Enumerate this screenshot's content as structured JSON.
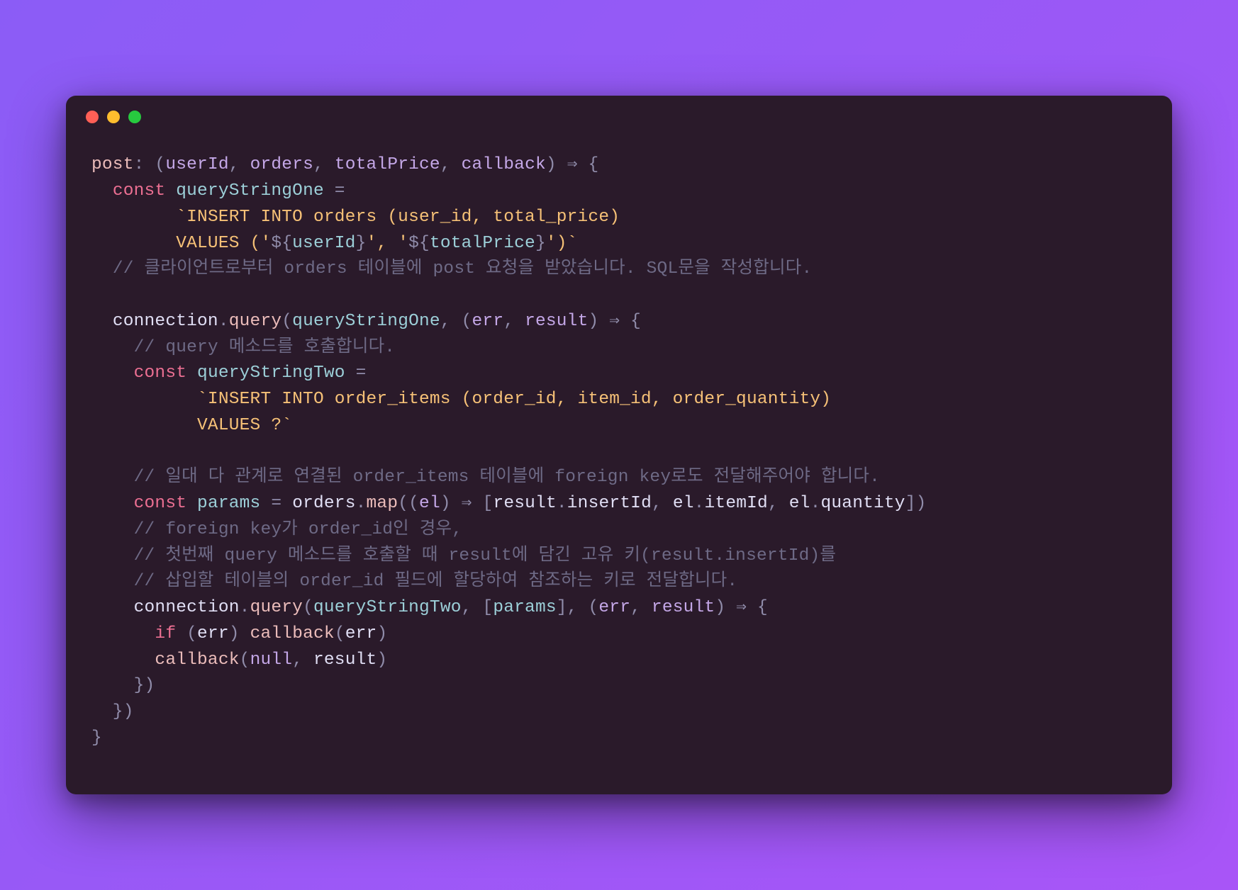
{
  "theme": {
    "bg_gradient_from": "#8b5cf6",
    "bg_gradient_to": "#a855f7",
    "window_bg": "#2a1a2a",
    "dot_red": "#ff5f56",
    "dot_yellow": "#ffbd2e",
    "dot_green": "#27c93f",
    "text_default": "#e0def4",
    "text_keyword": "#eb6f92",
    "text_function": "#ebbcba",
    "text_param": "#c4a7e7",
    "text_variable": "#9ccfd8",
    "text_punct": "#908caa",
    "text_string": "#f6c177",
    "text_comment": "#6e6a86"
  },
  "code": {
    "lines": [
      [
        {
          "t": "post",
          "c": "c-fn"
        },
        {
          "t": ": (",
          "c": "c-punct"
        },
        {
          "t": "userId",
          "c": "c-param"
        },
        {
          "t": ", ",
          "c": "c-punct"
        },
        {
          "t": "orders",
          "c": "c-param"
        },
        {
          "t": ", ",
          "c": "c-punct"
        },
        {
          "t": "totalPrice",
          "c": "c-param"
        },
        {
          "t": ", ",
          "c": "c-punct"
        },
        {
          "t": "callback",
          "c": "c-param"
        },
        {
          "t": ") ",
          "c": "c-punct"
        },
        {
          "t": "⇒",
          "c": "c-punct"
        },
        {
          "t": " {",
          "c": "c-punct"
        }
      ],
      [
        {
          "t": "  ",
          "c": "c-punct"
        },
        {
          "t": "const",
          "c": "c-key"
        },
        {
          "t": " ",
          "c": ""
        },
        {
          "t": "queryStringOne",
          "c": "c-var"
        },
        {
          "t": " = ",
          "c": "c-punct"
        }
      ],
      [
        {
          "t": "        ",
          "c": ""
        },
        {
          "t": "`INSERT INTO orders (user_id, total_price) ",
          "c": "c-str"
        }
      ],
      [
        {
          "t": "        VALUES ('",
          "c": "c-str"
        },
        {
          "t": "${",
          "c": "c-punct"
        },
        {
          "t": "userId",
          "c": "c-tmpl"
        },
        {
          "t": "}",
          "c": "c-punct"
        },
        {
          "t": "', '",
          "c": "c-str"
        },
        {
          "t": "${",
          "c": "c-punct"
        },
        {
          "t": "totalPrice",
          "c": "c-tmpl"
        },
        {
          "t": "}",
          "c": "c-punct"
        },
        {
          "t": "')`",
          "c": "c-str"
        }
      ],
      [
        {
          "t": "  ",
          "c": ""
        },
        {
          "t": "// 클라이언트로부터 orders 테이블에 post 요청을 받았습니다. SQL문을 작성합니다.",
          "c": "c-comment"
        }
      ],
      [
        {
          "t": " ",
          "c": ""
        }
      ],
      [
        {
          "t": "  ",
          "c": ""
        },
        {
          "t": "connection",
          "c": "c-ident"
        },
        {
          "t": ".",
          "c": "c-punct"
        },
        {
          "t": "query",
          "c": "c-fn"
        },
        {
          "t": "(",
          "c": "c-punct"
        },
        {
          "t": "queryStringOne",
          "c": "c-var"
        },
        {
          "t": ", (",
          "c": "c-punct"
        },
        {
          "t": "err",
          "c": "c-param"
        },
        {
          "t": ", ",
          "c": "c-punct"
        },
        {
          "t": "result",
          "c": "c-param"
        },
        {
          "t": ") ",
          "c": "c-punct"
        },
        {
          "t": "⇒",
          "c": "c-punct"
        },
        {
          "t": " {",
          "c": "c-punct"
        }
      ],
      [
        {
          "t": "    ",
          "c": ""
        },
        {
          "t": "// query 메소드를 호출합니다.",
          "c": "c-comment"
        }
      ],
      [
        {
          "t": "    ",
          "c": ""
        },
        {
          "t": "const",
          "c": "c-key"
        },
        {
          "t": " ",
          "c": ""
        },
        {
          "t": "queryStringTwo",
          "c": "c-var"
        },
        {
          "t": " = ",
          "c": "c-punct"
        }
      ],
      [
        {
          "t": "          ",
          "c": ""
        },
        {
          "t": "`INSERT INTO order_items (order_id, item_id, order_quantity) ",
          "c": "c-str"
        }
      ],
      [
        {
          "t": "          VALUES ?`",
          "c": "c-str"
        }
      ],
      [
        {
          "t": " ",
          "c": ""
        }
      ],
      [
        {
          "t": "    ",
          "c": ""
        },
        {
          "t": "// 일대 다 관계로 연결된 order_items 테이블에 foreign key로도 전달해주어야 합니다.",
          "c": "c-comment"
        }
      ],
      [
        {
          "t": "    ",
          "c": ""
        },
        {
          "t": "const",
          "c": "c-key"
        },
        {
          "t": " ",
          "c": ""
        },
        {
          "t": "params",
          "c": "c-var"
        },
        {
          "t": " = ",
          "c": "c-punct"
        },
        {
          "t": "orders",
          "c": "c-ident"
        },
        {
          "t": ".",
          "c": "c-punct"
        },
        {
          "t": "map",
          "c": "c-fn"
        },
        {
          "t": "((",
          "c": "c-punct"
        },
        {
          "t": "el",
          "c": "c-param"
        },
        {
          "t": ") ",
          "c": "c-punct"
        },
        {
          "t": "⇒",
          "c": "c-punct"
        },
        {
          "t": " [",
          "c": "c-punct"
        },
        {
          "t": "result",
          "c": "c-ident"
        },
        {
          "t": ".",
          "c": "c-punct"
        },
        {
          "t": "insertId",
          "c": "c-prop"
        },
        {
          "t": ", ",
          "c": "c-punct"
        },
        {
          "t": "el",
          "c": "c-ident"
        },
        {
          "t": ".",
          "c": "c-punct"
        },
        {
          "t": "itemId",
          "c": "c-prop"
        },
        {
          "t": ", ",
          "c": "c-punct"
        },
        {
          "t": "el",
          "c": "c-ident"
        },
        {
          "t": ".",
          "c": "c-punct"
        },
        {
          "t": "quantity",
          "c": "c-prop"
        },
        {
          "t": "])",
          "c": "c-punct"
        }
      ],
      [
        {
          "t": "    ",
          "c": ""
        },
        {
          "t": "// foreign key가 order_id인 경우,",
          "c": "c-comment"
        }
      ],
      [
        {
          "t": "    ",
          "c": ""
        },
        {
          "t": "// 첫번째 query 메소드를 호출할 때 result에 담긴 고유 키(result.insertId)를",
          "c": "c-comment"
        }
      ],
      [
        {
          "t": "    ",
          "c": ""
        },
        {
          "t": "// 삽입할 테이블의 order_id 필드에 할당하여 참조하는 키로 전달합니다.",
          "c": "c-comment"
        }
      ],
      [
        {
          "t": "    ",
          "c": ""
        },
        {
          "t": "connection",
          "c": "c-ident"
        },
        {
          "t": ".",
          "c": "c-punct"
        },
        {
          "t": "query",
          "c": "c-fn"
        },
        {
          "t": "(",
          "c": "c-punct"
        },
        {
          "t": "queryStringTwo",
          "c": "c-var"
        },
        {
          "t": ", [",
          "c": "c-punct"
        },
        {
          "t": "params",
          "c": "c-var"
        },
        {
          "t": "], (",
          "c": "c-punct"
        },
        {
          "t": "err",
          "c": "c-param"
        },
        {
          "t": ", ",
          "c": "c-punct"
        },
        {
          "t": "result",
          "c": "c-param"
        },
        {
          "t": ") ",
          "c": "c-punct"
        },
        {
          "t": "⇒",
          "c": "c-punct"
        },
        {
          "t": " {",
          "c": "c-punct"
        }
      ],
      [
        {
          "t": "      ",
          "c": ""
        },
        {
          "t": "if",
          "c": "c-key"
        },
        {
          "t": " (",
          "c": "c-punct"
        },
        {
          "t": "err",
          "c": "c-ident"
        },
        {
          "t": ") ",
          "c": "c-punct"
        },
        {
          "t": "callback",
          "c": "c-fn"
        },
        {
          "t": "(",
          "c": "c-punct"
        },
        {
          "t": "err",
          "c": "c-ident"
        },
        {
          "t": ")",
          "c": "c-punct"
        }
      ],
      [
        {
          "t": "      ",
          "c": ""
        },
        {
          "t": "callback",
          "c": "c-fn"
        },
        {
          "t": "(",
          "c": "c-punct"
        },
        {
          "t": "null",
          "c": "c-null"
        },
        {
          "t": ", ",
          "c": "c-punct"
        },
        {
          "t": "result",
          "c": "c-ident"
        },
        {
          "t": ")",
          "c": "c-punct"
        }
      ],
      [
        {
          "t": "    })",
          "c": "c-punct"
        }
      ],
      [
        {
          "t": "  })",
          "c": "c-punct"
        }
      ],
      [
        {
          "t": "}",
          "c": "c-punct"
        }
      ]
    ]
  }
}
